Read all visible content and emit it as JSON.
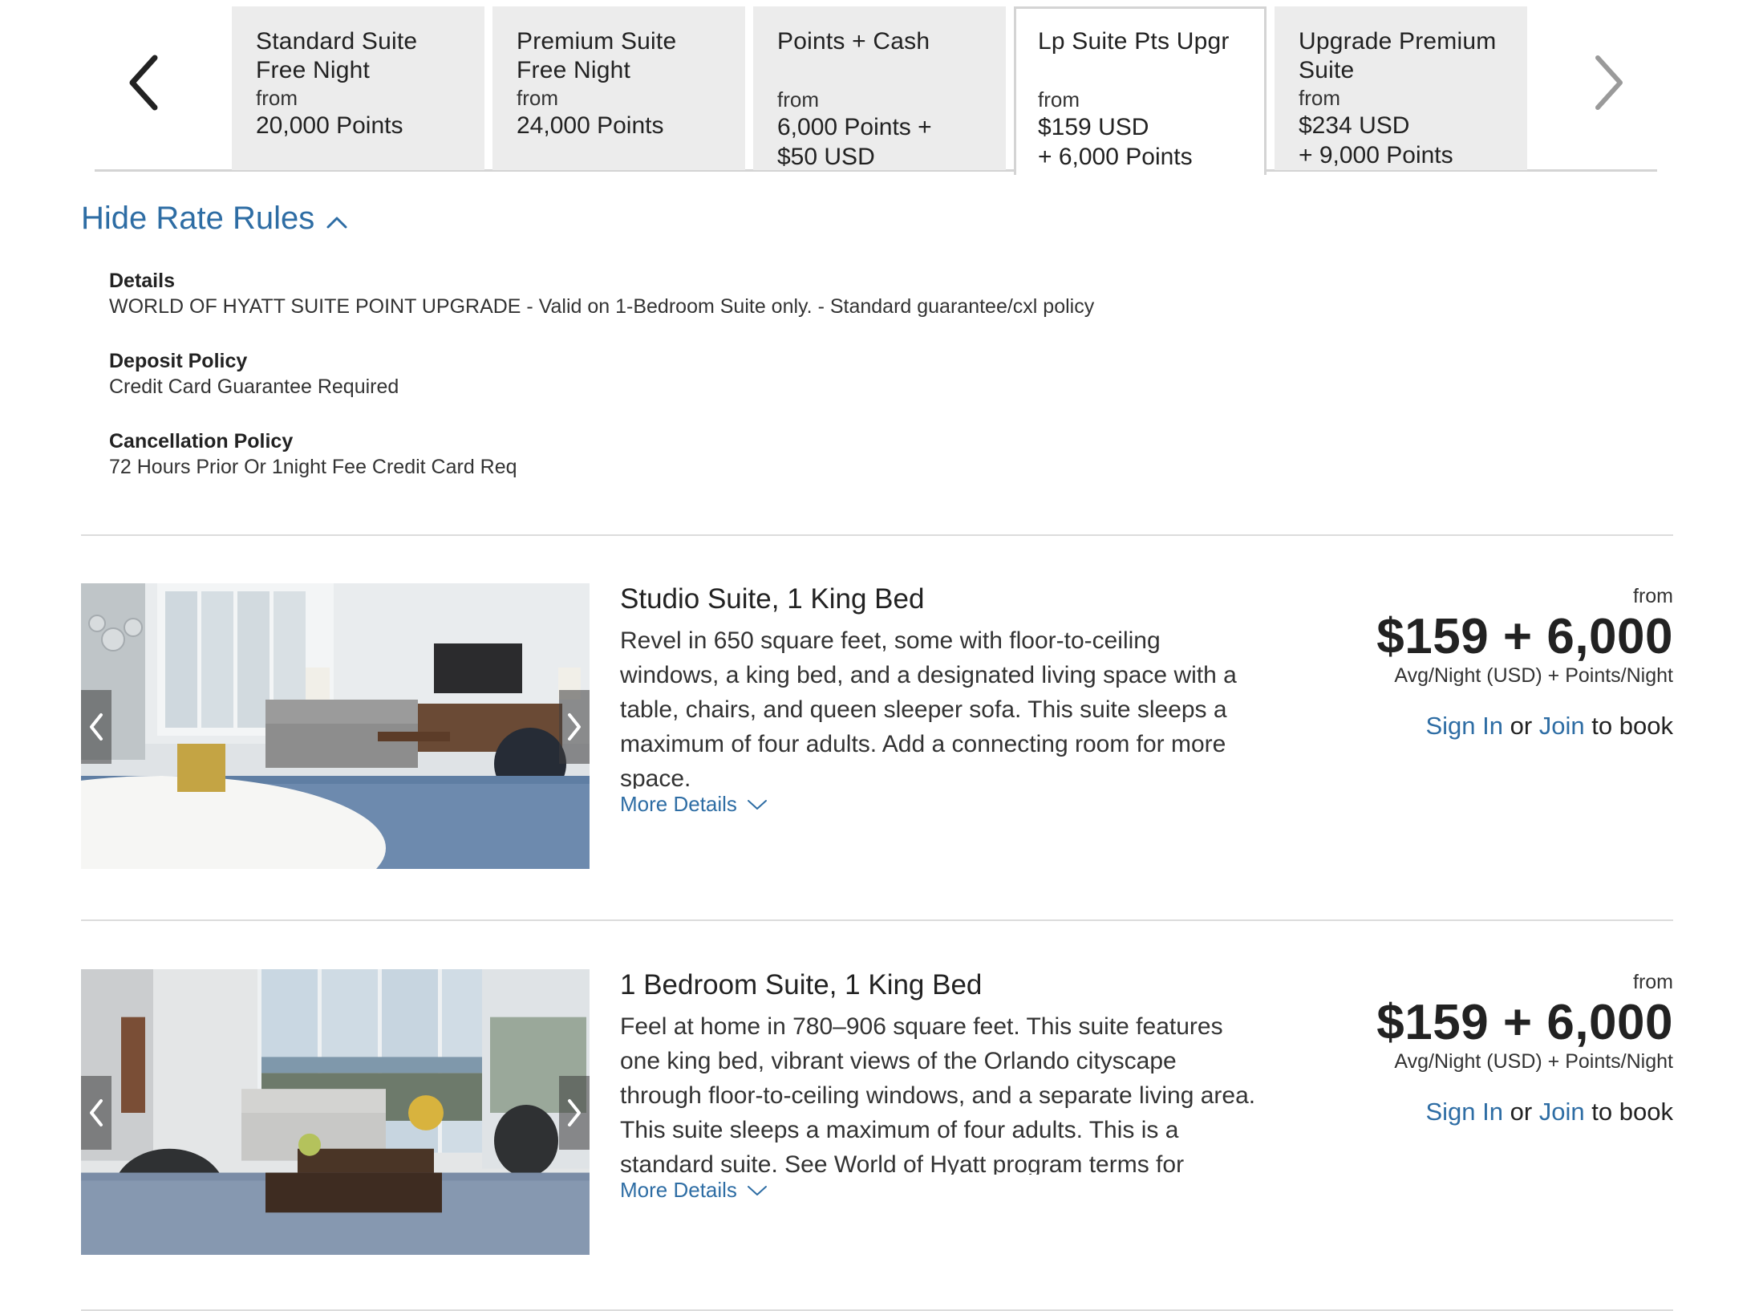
{
  "tabs": [
    {
      "name": "Standard Suite Free Night",
      "from": "from",
      "price": "20,000 Points",
      "active": false
    },
    {
      "name": "Premium Suite Free Night",
      "from": "from",
      "price": "24,000 Points",
      "active": false
    },
    {
      "name": "Points + Cash",
      "from": "from",
      "price": "6,000 Points +\n$50 USD",
      "active": false
    },
    {
      "name": "Lp Suite Pts Upgr",
      "from": "from",
      "price": "$159 USD\n+ 6,000 Points",
      "active": true
    },
    {
      "name": "Upgrade Premium Suite",
      "from": "from",
      "price": "$234 USD\n+ 9,000 Points",
      "active": false
    }
  ],
  "carousel": {
    "prev_icon": "chevron-left-icon",
    "next_icon": "chevron-right-icon"
  },
  "rate_rules": {
    "toggle_label": "Hide Rate Rules",
    "details_title": "Details",
    "details_text": "WORLD OF HYATT SUITE POINT UPGRADE - Valid on 1-Bedroom Suite only. - Standard guarantee/cxl policy",
    "deposit_title": "Deposit Policy",
    "deposit_text": "Credit Card Guarantee Required",
    "cancel_title": "Cancellation Policy",
    "cancel_text": "72 Hours Prior Or 1night Fee Credit Card Req"
  },
  "rooms": [
    {
      "title": "Studio Suite, 1 King Bed",
      "description": "Revel in 650 square feet, some with floor-to-ceiling windows, a king bed, and a designated living space with a table, chairs, and queen sleeper sofa. This suite sleeps a maximum of four adults. Add a connecting room for more space.",
      "more_details": "More Details",
      "price_from": "from",
      "price": "$159 + 6,000",
      "price_unit": "Avg/Night (USD) + Points/Night",
      "sign_in": "Sign In",
      "or": "or",
      "join": "Join",
      "to_book": "to book"
    },
    {
      "title": "1 Bedroom Suite, 1 King Bed",
      "description": "Feel at home in 780–906 square feet. This suite features one king bed, vibrant views of the Orlando cityscape through floor-to-ceiling windows, and a separate living area. This suite sleeps a maximum of four adults. This is a standard suite. See World of Hyatt program terms for",
      "more_details": "More Details",
      "price_from": "from",
      "price": "$159 + 6,000",
      "price_unit": "Avg/Night (USD) + Points/Night",
      "sign_in": "Sign In",
      "or": "or",
      "join": "Join",
      "to_book": "to book"
    }
  ],
  "colors": {
    "link": "#2e6da4",
    "tab_bg": "#ececec",
    "divider": "#dcdcdc"
  }
}
